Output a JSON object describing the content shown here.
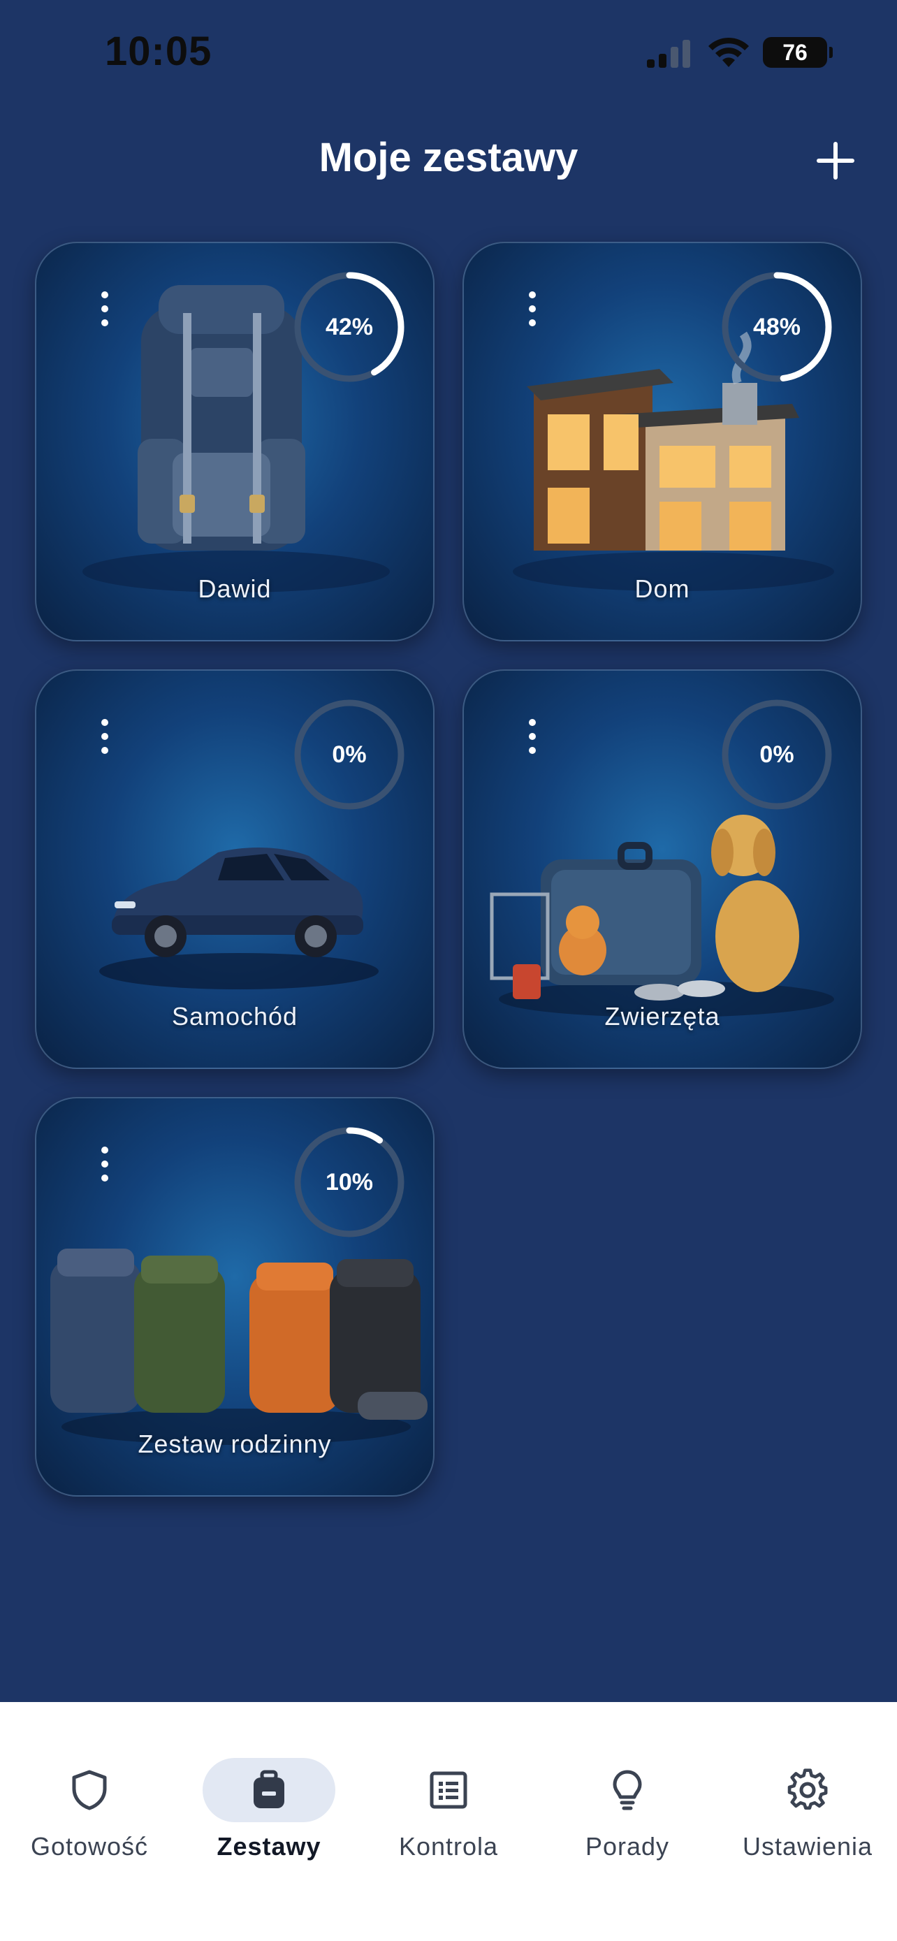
{
  "status": {
    "time": "10:05",
    "battery": "76"
  },
  "header": {
    "title": "Moje zestawy",
    "add_label": "+"
  },
  "kits": [
    {
      "name": "Dawid",
      "progress": 42,
      "progress_label": "42%",
      "icon": "backpack-illustration"
    },
    {
      "name": "Dom",
      "progress": 48,
      "progress_label": "48%",
      "icon": "house-illustration"
    },
    {
      "name": "Samochód",
      "progress": 0,
      "progress_label": "0%",
      "icon": "car-illustration"
    },
    {
      "name": "Zwierzęta",
      "progress": 0,
      "progress_label": "0%",
      "icon": "pets-illustration"
    },
    {
      "name": "Zestaw rodzinny",
      "progress": 10,
      "progress_label": "10%",
      "icon": "family-backpacks-illustration"
    }
  ],
  "tabs": [
    {
      "label": "Gotowość",
      "icon": "shield-icon",
      "active": false
    },
    {
      "label": "Zestawy",
      "icon": "backpack-icon",
      "active": true
    },
    {
      "label": "Kontrola",
      "icon": "checklist-icon",
      "active": false
    },
    {
      "label": "Porady",
      "icon": "lightbulb-icon",
      "active": false
    },
    {
      "label": "Ustawienia",
      "icon": "gear-icon",
      "active": false
    }
  ],
  "colors": {
    "background": "#1d3566",
    "card": "#12417a",
    "ring_track": "#3a5272",
    "ring_fill": "#ffffff",
    "tab_active_pill": "#e2e8f3"
  }
}
